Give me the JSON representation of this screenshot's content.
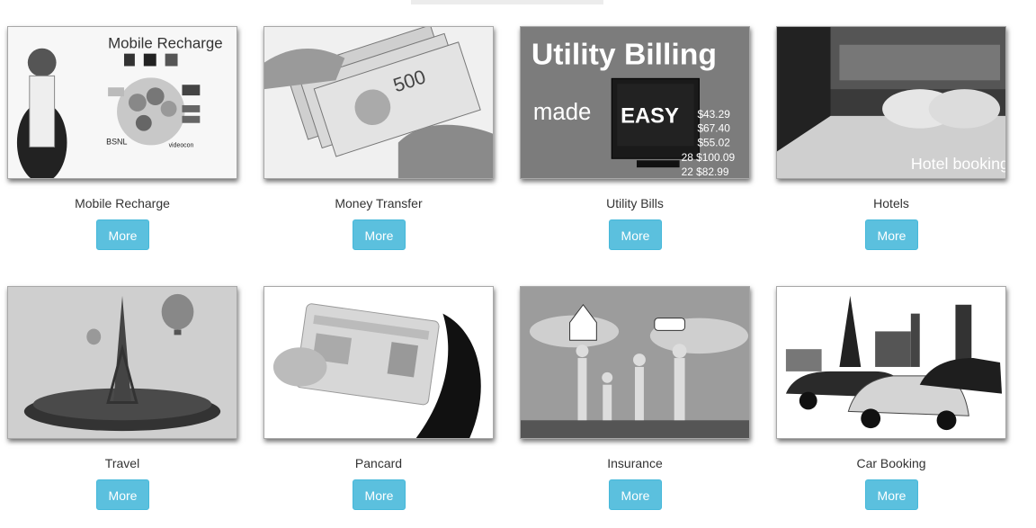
{
  "services": [
    {
      "caption": "Mobile Recharge",
      "button": "More",
      "image_text": "Mobile Recharge"
    },
    {
      "caption": "Money Transfer",
      "button": "More",
      "image_text": ""
    },
    {
      "caption": "Utility Bills",
      "button": "More",
      "image_text": "Utility Billing",
      "image_text2": "made",
      "image_text3": "EASY",
      "image_amounts": [
        "$43.29",
        "$67.40",
        "$55.02",
        "28 $100.09",
        "22 $82.99"
      ]
    },
    {
      "caption": "Hotels",
      "button": "More",
      "image_text": "Hotel booking"
    },
    {
      "caption": "Travel",
      "button": "More",
      "image_text": ""
    },
    {
      "caption": "Pancard",
      "button": "More",
      "image_text": ""
    },
    {
      "caption": "Insurance",
      "button": "More",
      "image_text": ""
    },
    {
      "caption": "Car Booking",
      "button": "More",
      "image_text": ""
    }
  ]
}
